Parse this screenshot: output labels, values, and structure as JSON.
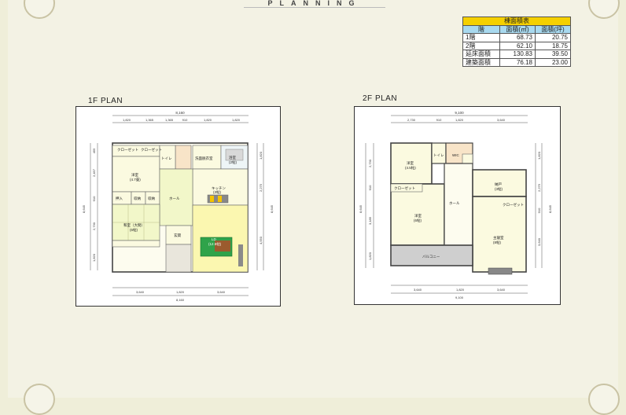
{
  "header": {
    "title": "PLANNING"
  },
  "area_table": {
    "title": "棟面積表",
    "headers": [
      "階",
      "面積(㎡)",
      "面積(坪)"
    ],
    "rows": [
      {
        "label": "1階",
        "m2": "68.73",
        "tsubo": "20.75"
      },
      {
        "label": "2階",
        "m2": "62.10",
        "tsubo": "18.75"
      },
      {
        "label": "延床面積",
        "m2": "130.83",
        "tsubo": "39.50"
      },
      {
        "label": "建築面積",
        "m2": "76.18",
        "tsubo": "23.00"
      }
    ]
  },
  "plan1": {
    "title": "1F PLAN",
    "top_total": "8,160",
    "top_dims": [
      "1,820",
      "1,365",
      "1,365",
      "910",
      "1,820",
      "1,820"
    ],
    "bottom_dims": [
      "3,640",
      "1,820",
      "3,640"
    ],
    "bottom_total": "8,160",
    "left_total": "8,645",
    "left_dims": [
      "455",
      "2,457",
      "910",
      "2,730",
      "1,820"
    ],
    "right_total": "8,645",
    "right_dims": [
      "1,820",
      "2,275",
      "4,550"
    ],
    "rooms": {
      "closet1": "クローゼット",
      "closet2": "クローゼット",
      "washitsu_west": "洋室",
      "washitsu_west_size": "(4.7畳)",
      "toilet": "トイレ",
      "wash": "洗面脱衣室",
      "bath": "浴室",
      "bath_size": "(2帖)",
      "kitchen": "キッチン",
      "kitchen_size": "(3帖)",
      "oshiire": "押入",
      "storage1": "収納",
      "storage2": "収納",
      "hall": "ホール",
      "washitsu": "和室（大間）",
      "washitsu_size": "(6帖)",
      "genkan": "玄関",
      "ld": "LD",
      "ld_size": "(12.5帖)"
    },
    "colors": {
      "ld": "#fbf7b0",
      "hall": "#f2f7c9",
      "rooms": "#fbfae0",
      "green": "#2fa34a"
    }
  },
  "plan2": {
    "title": "2F PLAN",
    "top_total": "9,100",
    "top_dims": [
      "2,730",
      "910",
      "1,820",
      "3,640"
    ],
    "bottom_dims": [
      "3,640",
      "1,820",
      "3,640"
    ],
    "bottom_total": "9,100",
    "left_total": "8,645",
    "left_dims": [
      "2,730",
      "910",
      "3,185",
      "1,820"
    ],
    "right_total": "8,645",
    "right_dims": [
      "1,820",
      "2,275",
      "910",
      "3,640"
    ],
    "rooms": {
      "room1": "洋室",
      "room1_size": "(4.5帖)",
      "toilet": "トイレ",
      "wic": "WIC",
      "room2": "洋室",
      "room2_size": "(6帖)",
      "hall": "ホール",
      "closet": "クローゼット",
      "closet2": "クローゼット",
      "wic2": "納戸",
      "wic2_size": "(3帖)",
      "master": "主寝室",
      "master_size": "(8帖)",
      "balcony": "バルコニー"
    }
  }
}
